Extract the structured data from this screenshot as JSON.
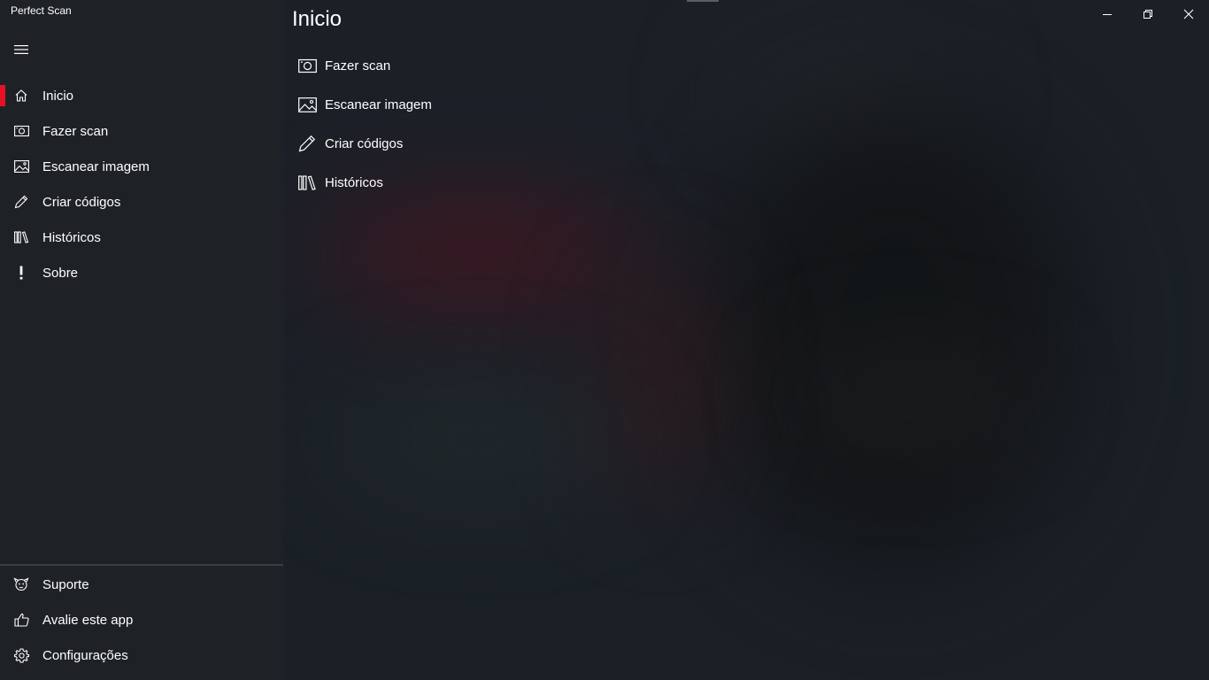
{
  "app": {
    "title": "Perfect Scan"
  },
  "window_controls": {
    "minimize_icon": "minimize-icon",
    "maximize_icon": "restore-icon",
    "close_icon": "close-icon"
  },
  "sidebar": {
    "menu_icon": "hamburger-menu-icon",
    "items": [
      {
        "label": "Inicio",
        "icon": "home-icon",
        "active": true
      },
      {
        "label": "Fazer scan",
        "icon": "camera-icon"
      },
      {
        "label": "Escanear imagem",
        "icon": "image-icon"
      },
      {
        "label": "Criar códigos",
        "icon": "pencil-icon"
      },
      {
        "label": "Históricos",
        "icon": "library-icon"
      },
      {
        "label": "Sobre",
        "icon": "exclamation-icon"
      }
    ],
    "footer_items": [
      {
        "label": "Suporte",
        "icon": "support-icon"
      },
      {
        "label": "Avalie este app",
        "icon": "thumbs-up-icon"
      },
      {
        "label": "Configurações",
        "icon": "gear-icon"
      }
    ]
  },
  "main": {
    "title": "Inicio",
    "items": [
      {
        "label": "Fazer scan",
        "icon": "camera-icon"
      },
      {
        "label": "Escanear imagem",
        "icon": "image-icon"
      },
      {
        "label": "Criar códigos",
        "icon": "pencil-icon"
      },
      {
        "label": "Históricos",
        "icon": "library-icon"
      }
    ]
  },
  "colors": {
    "accent": "#e81123",
    "sidebar_bg": "#1e2227",
    "background": "#1b2027",
    "text": "#ffffff"
  }
}
